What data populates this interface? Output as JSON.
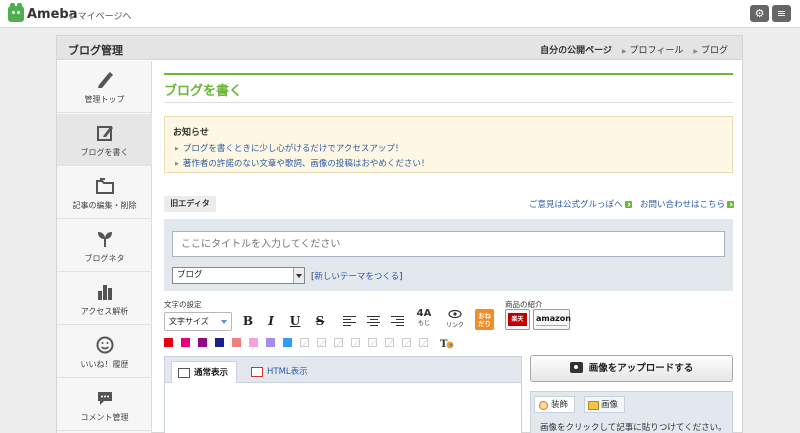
{
  "topbar": {
    "logo_text": "Ameba",
    "mypage_link": "マイページへ",
    "settings_icon": "gear-icon",
    "menu_icon": "menu-icon"
  },
  "panel": {
    "title": "ブログ管理",
    "links": [
      "自分の公開ページ",
      "プロフィール",
      "ブログ"
    ]
  },
  "sidebar": {
    "items": [
      {
        "label": "管理トップ",
        "icon": "pencil-icon"
      },
      {
        "label": "ブログを書く",
        "icon": "write-icon"
      },
      {
        "label": "記事の編集・削除",
        "icon": "folder-icon"
      },
      {
        "label": "ブログネタ",
        "icon": "sprout-icon"
      },
      {
        "label": "アクセス解析",
        "icon": "bar-chart-icon"
      },
      {
        "label": "いいね！履歴",
        "icon": "smile-icon"
      },
      {
        "label": "コメント管理",
        "icon": "speech-bubble-icon"
      }
    ]
  },
  "main": {
    "title": "ブログを書く",
    "notice": {
      "title": "お知らせ",
      "items": [
        "ブログを書くときに少し心がけるだけでアクセスアップ！",
        "著作者の許諾のない文章や歌詞、画像の投稿はおやめください！"
      ]
    },
    "old_editor": "旧エディタ",
    "feedback_link": "ご意見は公式グルっぽへ",
    "contact_link": "お問い合わせはこちら",
    "title_placeholder": "ここにタイトルを入力してください",
    "theme_select": "ブログ",
    "new_theme_link": "新しいテーマをつくる",
    "font_settings_label": "文字の設定",
    "products_label": "商品の紹介",
    "font_size_select": "文字サイズ",
    "toolbar": {
      "bold": "B",
      "italic": "I",
      "underline": "U",
      "strike": "S",
      "emoji_label": "もじ",
      "link_label": "リンク",
      "onedari": "おねだり",
      "rakuten": "楽天",
      "amazon": "amazon"
    },
    "colors": [
      "#e60012",
      "#e4007f",
      "#920783",
      "#1d2088",
      "#f08080",
      "#f4a3d9",
      "#a58ee6",
      "#2d9ef7"
    ],
    "tabs": {
      "normal": "通常表示",
      "html": "HTML表示"
    },
    "upload_button": "画像をアップロードする",
    "side_tabs": {
      "deco": "装飾",
      "image": "画像"
    },
    "image_hint": "画像をクリックして記事に貼りつけてください。"
  }
}
